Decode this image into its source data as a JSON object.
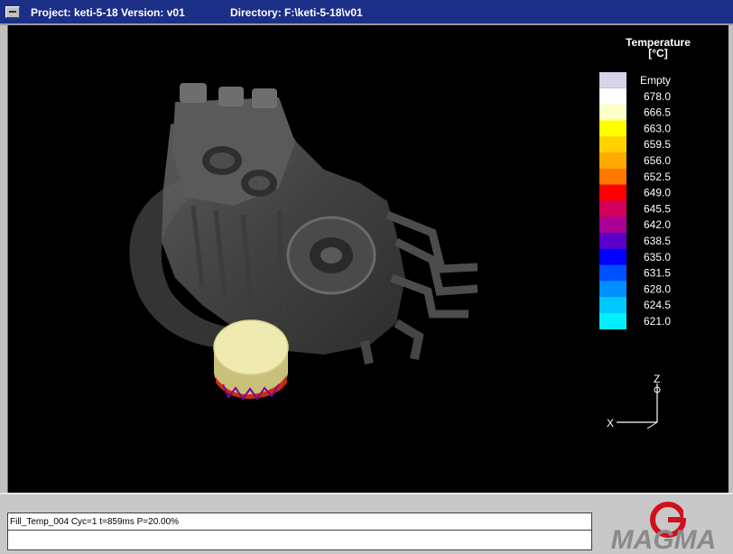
{
  "window": {
    "title_project": "Project: keti-5-18    Version: v01",
    "title_directory": "Directory: F:\\keti-5-18\\v01"
  },
  "legend": {
    "title_line1": "Temperature",
    "title_line2": "[°C]",
    "empty_label": "Empty",
    "empty_color": "#d8d2ea",
    "items": [
      {
        "label": "678.0",
        "color": "#ffffff"
      },
      {
        "label": "666.5",
        "color": "#ffffc8"
      },
      {
        "label": "663.0",
        "color": "#ffff00"
      },
      {
        "label": "659.5",
        "color": "#ffd200"
      },
      {
        "label": "656.0",
        "color": "#ffaa00"
      },
      {
        "label": "652.5",
        "color": "#ff7800"
      },
      {
        "label": "649.0",
        "color": "#ff0000"
      },
      {
        "label": "645.5",
        "color": "#d2005a"
      },
      {
        "label": "642.0",
        "color": "#aa0096"
      },
      {
        "label": "638.5",
        "color": "#5a00c8"
      },
      {
        "label": "635.0",
        "color": "#0000ff"
      },
      {
        "label": "631.5",
        "color": "#0050ff"
      },
      {
        "label": "628.0",
        "color": "#0090ff"
      },
      {
        "label": "624.5",
        "color": "#00c8ff"
      },
      {
        "label": "621.0",
        "color": "#00f0ff"
      }
    ]
  },
  "axes": {
    "z": "Z",
    "x": "X"
  },
  "status": {
    "line1": "Fill_Temp_004 Cyc=1 t=859ms P=20.00%",
    "line2": ""
  },
  "logo": {
    "text": "MAGMA",
    "accent": "#d0101c",
    "base": "#8a8a8a"
  }
}
